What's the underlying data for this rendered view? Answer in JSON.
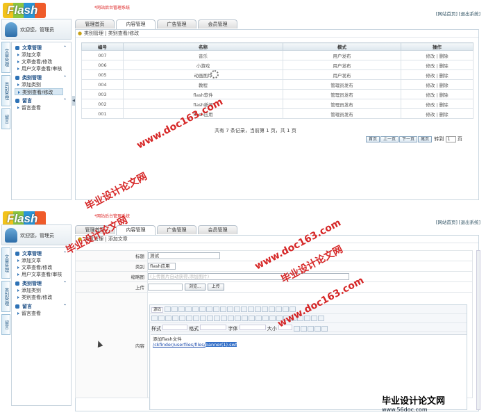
{
  "top": {
    "logo": "Flash",
    "title": "*网站后台管理系统",
    "links": [
      "[网站首页]",
      "[退出系统]"
    ],
    "welcome": "欢迎您，管理员"
  },
  "tabs": [
    "管理首页",
    "内容管理",
    "广告管理",
    "会员管理"
  ],
  "vtabs": [
    "文章管理",
    "类别管理",
    "留言"
  ],
  "sidebar": {
    "groups": [
      {
        "title": "文章管理",
        "items": [
          "添加文章",
          "文章查看/修改",
          "用户文章查看/审核"
        ]
      },
      {
        "title": "类别管理",
        "items": [
          "添加类别",
          "类别查看/修改"
        ]
      },
      {
        "title": "留言",
        "items": [
          "留言查看"
        ]
      }
    ]
  },
  "screen1": {
    "breadcrumb": "类别管理 | 类别查看/修改",
    "columns": [
      "编号",
      "名称",
      "模式",
      "操作"
    ],
    "rows": [
      [
        "007",
        "音乐",
        "用户发布",
        "修改 | 删除"
      ],
      [
        "006",
        "小游戏",
        "用户发布",
        "修改 | 删除"
      ],
      [
        "005",
        "动画图片",
        "用户发布",
        "修改 | 删除"
      ],
      [
        "004",
        "教程",
        "管理员发布",
        "修改 | 删除"
      ],
      [
        "003",
        "flash软件",
        "管理员发布",
        "修改 | 删除"
      ],
      [
        "002",
        "flash新闻",
        "管理员发布",
        "修改 | 删除"
      ],
      [
        "001",
        "flash应用",
        "管理员发布",
        "修改 | 删除"
      ]
    ],
    "pager_text": "共有 7 条记录，当前第 1 页，共 1 页",
    "pager_buttons": [
      "首页",
      "上一页",
      "下一页",
      "尾页"
    ],
    "goto_label": "转到",
    "page_value": "1",
    "page_unit": "页"
  },
  "screen2": {
    "breadcrumb": "文章管理 | 添加文章",
    "labels": {
      "title": "标题",
      "category": "类别",
      "thumb": "缩略图",
      "upload": "上传",
      "content": "内容"
    },
    "title_value": "测试",
    "category_value": "flash应用",
    "thumb_hint": "(上传图片自动获得,添加图片)",
    "browse": "浏览...",
    "upload_button": "上传",
    "toolbar": {
      "source": "源码",
      "style": "样式",
      "format": "格式",
      "font": "字体",
      "size": "大小"
    },
    "content_text": "添加flash文件",
    "content_link": "/ckfinder/userfiles/files/",
    "content_link_hl": "banner(1).swf"
  },
  "watermarks": {
    "doc": "www.doc163.com",
    "thesis": "毕业设计论文网",
    "site": "www.56doc.com"
  }
}
